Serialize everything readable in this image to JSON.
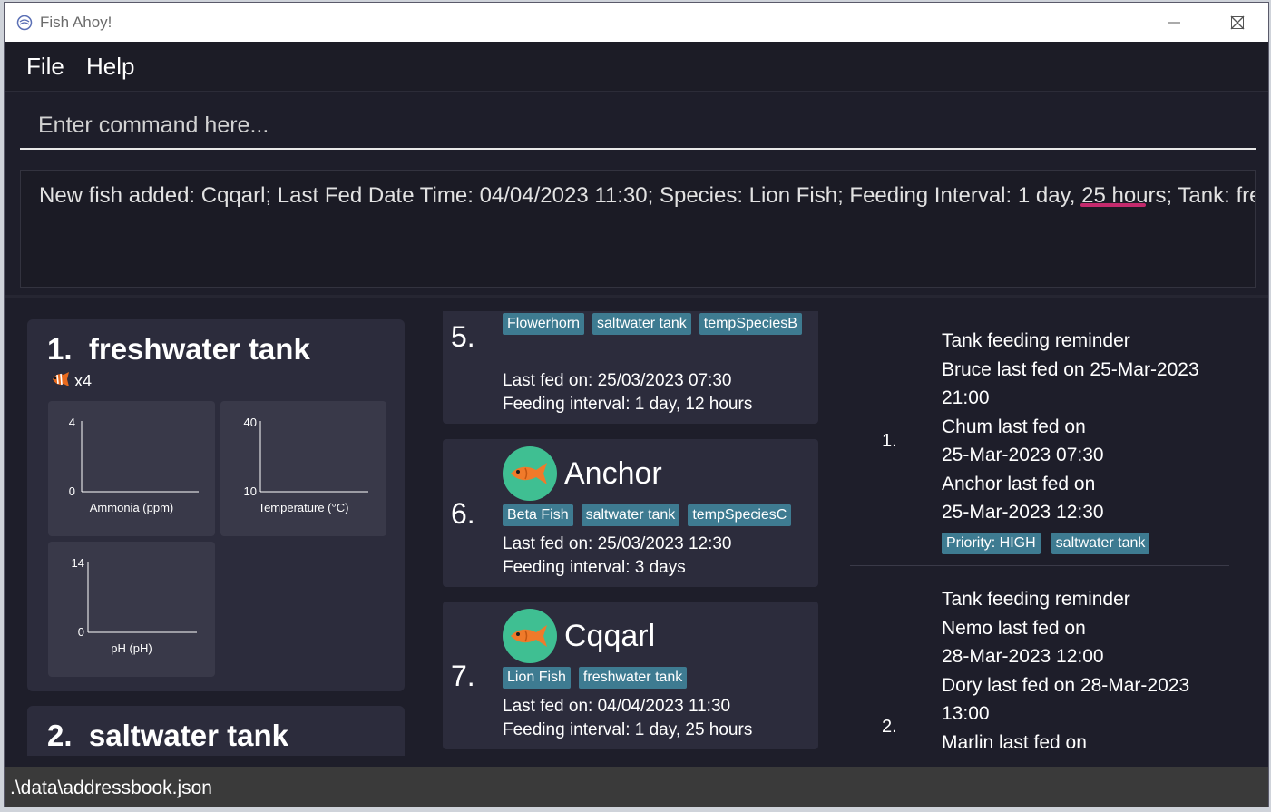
{
  "window": {
    "title": "Fish Ahoy!"
  },
  "menu": {
    "file": "File",
    "help": "Help"
  },
  "command": {
    "placeholder": "Enter command here..."
  },
  "result": {
    "text": "New fish added: Cqqarl; Last Fed Date Time: 04/04/2023 11:30; Species: Lion Fish; Feeding Interval: 1 day, 25 hours; Tank: freshwater tank"
  },
  "tanks": [
    {
      "index": "1.",
      "name": "freshwater tank",
      "fish_count": "x4",
      "charts": [
        {
          "label": "Ammonia (ppm)",
          "ymax": "4",
          "ymin": "0"
        },
        {
          "label": "Temperature (°C)",
          "ymax": "40",
          "ymin": "10"
        },
        {
          "label": "pH (pH)",
          "ymax": "14",
          "ymin": "0"
        }
      ]
    },
    {
      "index": "2.",
      "name": "saltwater tank"
    }
  ],
  "fishes": [
    {
      "index": "5.",
      "tags": [
        "Flowerhorn",
        "saltwater tank",
        "tempSpeciesB"
      ],
      "last_fed": "Last fed on: 25/03/2023 07:30",
      "interval": "Feeding interval: 1 day, 12 hours"
    },
    {
      "index": "6.",
      "name": "Anchor",
      "tags": [
        "Beta Fish",
        "saltwater tank",
        "tempSpeciesC"
      ],
      "last_fed": "Last fed on: 25/03/2023 12:30",
      "interval": "Feeding interval: 3 days"
    },
    {
      "index": "7.",
      "name": "Cqqarl",
      "tags": [
        "Lion Fish",
        "freshwater tank"
      ],
      "last_fed": "Last fed on: 04/04/2023 11:30",
      "interval": "Feeding interval: 1 day, 25 hours"
    }
  ],
  "reminders": [
    {
      "index": "1.",
      "lines": [
        "Tank feeding reminder",
        "Bruce last fed on 25-Mar-2023",
        "21:00",
        "Chum last fed on",
        "25-Mar-2023 07:30",
        "Anchor last fed on",
        "25-Mar-2023 12:30"
      ],
      "tags": [
        "Priority: HIGH",
        "saltwater tank"
      ]
    },
    {
      "index": "2.",
      "lines": [
        "Tank feeding reminder",
        "Nemo last fed on",
        "28-Mar-2023 12:00",
        "Dory last fed on 28-Mar-2023",
        "13:00",
        "Marlin last fed on"
      ]
    }
  ],
  "status": {
    "path": ".\\data\\addressbook.json"
  },
  "colors": {
    "background": "#1e1e2a",
    "card": "#2c2c3c",
    "tag": "#3e7b91",
    "avatar": "#3fbf92",
    "fish": "#f07a2a"
  }
}
